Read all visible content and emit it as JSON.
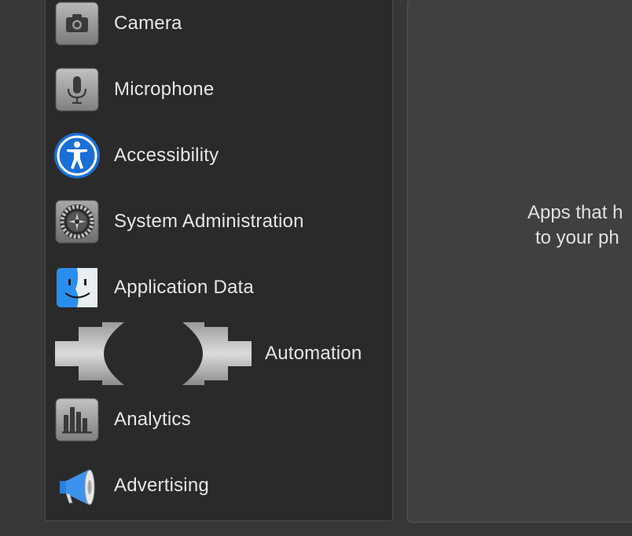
{
  "sidebar": {
    "items": [
      {
        "label": "Camera",
        "icon": "camera-icon"
      },
      {
        "label": "Microphone",
        "icon": "microphone-icon"
      },
      {
        "label": "Accessibility",
        "icon": "accessibility-icon"
      },
      {
        "label": "System Administration",
        "icon": "system-preferences-gear-icon"
      },
      {
        "label": "Application Data",
        "icon": "finder-icon"
      },
      {
        "label": "Automation",
        "icon": "automation-gear-icon"
      },
      {
        "label": "Analytics",
        "icon": "analytics-bar-chart-icon"
      },
      {
        "label": "Advertising",
        "icon": "megaphone-icon"
      }
    ]
  },
  "detail": {
    "message_line1": "Apps that h",
    "message_line2": "to your ph"
  },
  "colors": {
    "background": "#373737",
    "sidebar": "#2a2a2a",
    "panel": "#404040",
    "text": "#e6e6e6",
    "accessibility_blue": "#1a6fd6",
    "finder_blue": "#2a8ef0"
  }
}
